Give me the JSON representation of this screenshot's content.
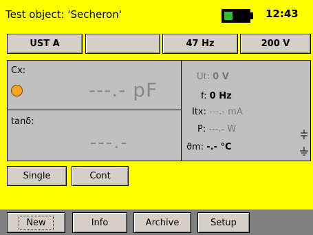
{
  "title_bar": {
    "title": "Test object: 'Secheron'",
    "time": "12:43",
    "battery_level": 0.35,
    "battery_color": "#2fbf2f"
  },
  "params": {
    "mode_label": "UST A",
    "blank_label": "",
    "frequency_label": "47 Hz",
    "voltage_label": "200 V"
  },
  "measurement": {
    "cx_label": "Cx:",
    "cx_value": "---.- pF",
    "status_color": "#f5a623",
    "tan_label": "tanδ:",
    "tan_value": "---.-",
    "ut_label": "Ut:",
    "ut_value": "0 V",
    "f_label": "f:",
    "f_value": "0 Hz",
    "itx_label": "Itx:",
    "itx_value": "---.- mA",
    "p_label": "P:",
    "p_value": "---.- W",
    "temp_label": "ϑm:",
    "temp_value": "-.- °C",
    "icons": [
      "guard-icon",
      "ground-icon"
    ]
  },
  "mode_buttons": {
    "single": "Single",
    "cont": "Cont"
  },
  "menu": {
    "new": "New",
    "info": "Info",
    "archive": "Archive",
    "setup": "Setup"
  },
  "colors": {
    "background": "#ffff00",
    "panel": "#c0c0c0",
    "menu_bar": "#808080"
  }
}
